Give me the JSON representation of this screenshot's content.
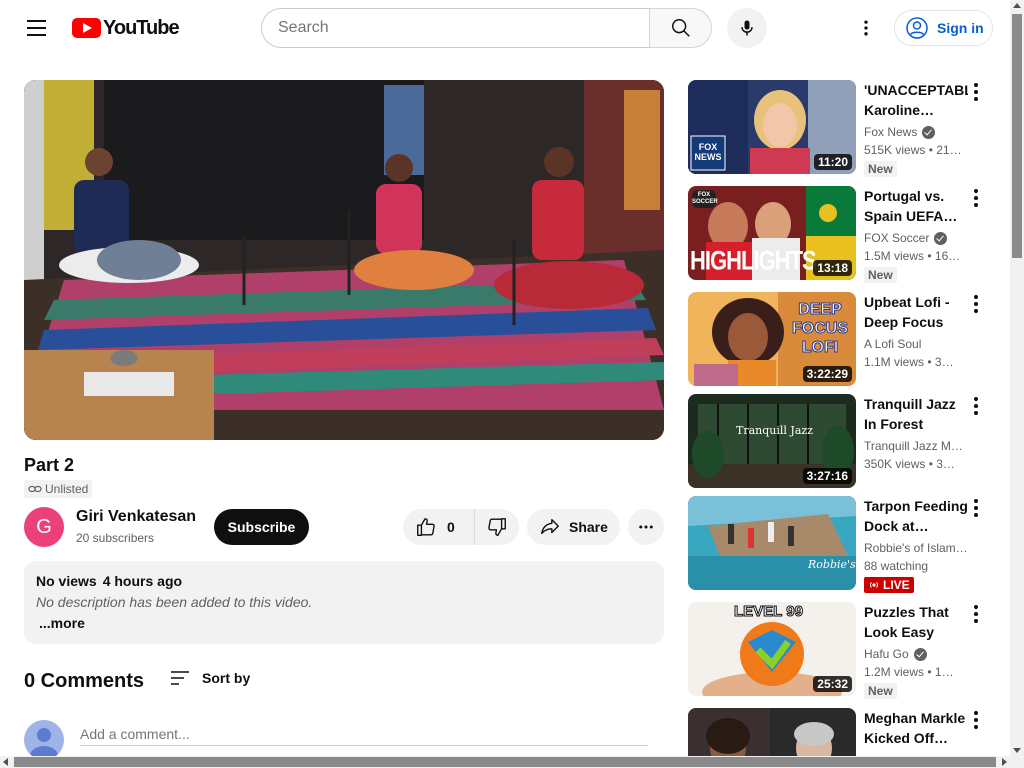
{
  "header": {
    "logo_text": "YouTube",
    "search_placeholder": "Search",
    "sign_in_label": "Sign in"
  },
  "video": {
    "title": "Part 2",
    "visibility": "Unlisted",
    "channel_initial": "G",
    "channel_name": "Giri Venkatesan",
    "subscribers": "20 subscribers",
    "subscribe_label": "Subscribe",
    "like_count": "0",
    "share_label": "Share",
    "views": "No views",
    "uploaded": "4 hours ago",
    "description": "No description has been added to this video.",
    "more_label": "...more"
  },
  "comments": {
    "count_label": "0 Comments",
    "sort_label": "Sort by",
    "add_placeholder": "Add a comment..."
  },
  "colors": {
    "accent": "#ff0000",
    "link": "#065fd4",
    "avatar": "#ec407a",
    "live": "#cc0000"
  },
  "recommendations": [
    {
      "title": "'UNACCEPTABL Karoline…",
      "channel": "Fox News",
      "verified": true,
      "views": "515K views",
      "age": "21…",
      "duration": "11:20",
      "badge": "New"
    },
    {
      "title": "Portugal vs. Spain UEFA…",
      "channel": "FOX Soccer",
      "verified": true,
      "views": "1.5M views",
      "age": "16…",
      "duration": "13:18",
      "badge": "New"
    },
    {
      "title": "Upbeat Lofi - Deep Focus &…",
      "channel": "A Lofi Soul",
      "verified": false,
      "views": "1.1M views",
      "age": "3…",
      "duration": "3:22:29",
      "badge": ""
    },
    {
      "title": "Tranquill Jazz In Forest Livin…",
      "channel": "Tranquill Jazz M…",
      "verified": false,
      "views": "350K views",
      "age": "3…",
      "duration": "3:27:16",
      "badge": ""
    },
    {
      "title": "Tarpon Feeding Dock at…",
      "channel": "Robbie's of Islam…",
      "verified": false,
      "views": "88 watching",
      "age": "",
      "duration": "",
      "badge": "LIVE"
    },
    {
      "title": "Puzzles That Look Easy But…",
      "channel": "Hafu Go",
      "verified": true,
      "views": "1.2M views",
      "age": "1…",
      "duration": "25:32",
      "badge": "New"
    },
    {
      "title": "Meghan Markle Kicked Off…",
      "channel": "",
      "verified": false,
      "views": "",
      "age": "",
      "duration": "",
      "badge": ""
    }
  ],
  "thumbnail_text": {
    "fox_logo": "FOX NEWS",
    "highlights": "HIGHLIGHTS",
    "fox_soccer": "FOX SOCCER",
    "deep_focus": "DEEP FOCUS LOFI",
    "tranquill": "Tranquill Jazz",
    "robbies": "Robbie's",
    "level": "LEVEL 99"
  }
}
